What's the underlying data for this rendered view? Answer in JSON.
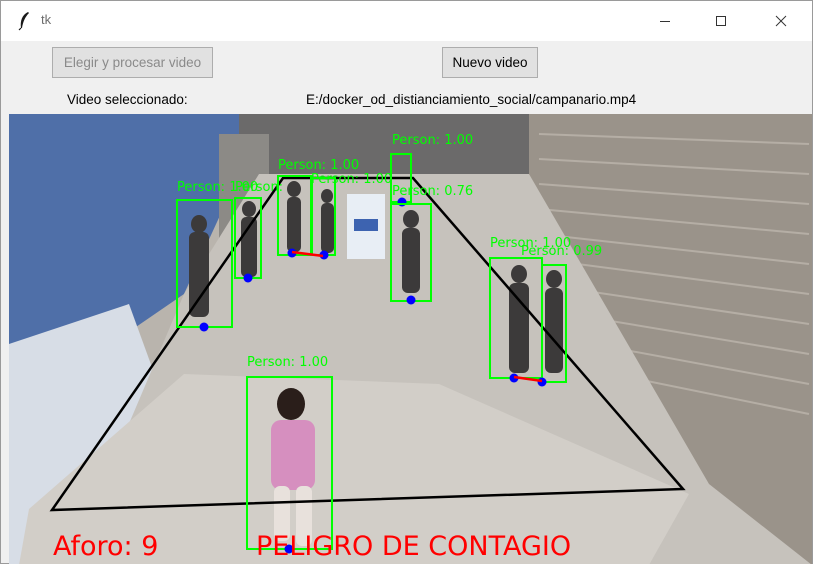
{
  "window": {
    "title": "tk",
    "icon": "feather-icon",
    "controls": [
      "minimize-icon",
      "maximize-icon",
      "close-icon"
    ]
  },
  "toolbar": {
    "process_label": "Elegir y procesar video",
    "new_label": "Nuevo video"
  },
  "selection": {
    "label": "Video seleccionado:",
    "path": "E:/docker_od_distianciamiento_social/campanario.mp4"
  },
  "video": {
    "detections": [
      {
        "label": "Person: 1.00"
      },
      {
        "label": "Person: 0.76"
      },
      {
        "label": "Person: 1.00"
      },
      {
        "label": "Person: 1.00"
      },
      {
        "label": "Person:"
      },
      {
        "label": "Person: 1.00"
      },
      {
        "label": "Person: 1.00"
      },
      {
        "label": "Person: 0.99"
      },
      {
        "label": "Person: 1.00"
      }
    ],
    "aforo_text": "Aforo: 9",
    "warning_text": "PELIGRO DE CONTAGIO",
    "colors": {
      "box": "#00ff00",
      "foot_point": "#0000ff",
      "violation_line": "#ff0000",
      "zone": "#000000",
      "overlay_text": "#ff0000"
    }
  }
}
